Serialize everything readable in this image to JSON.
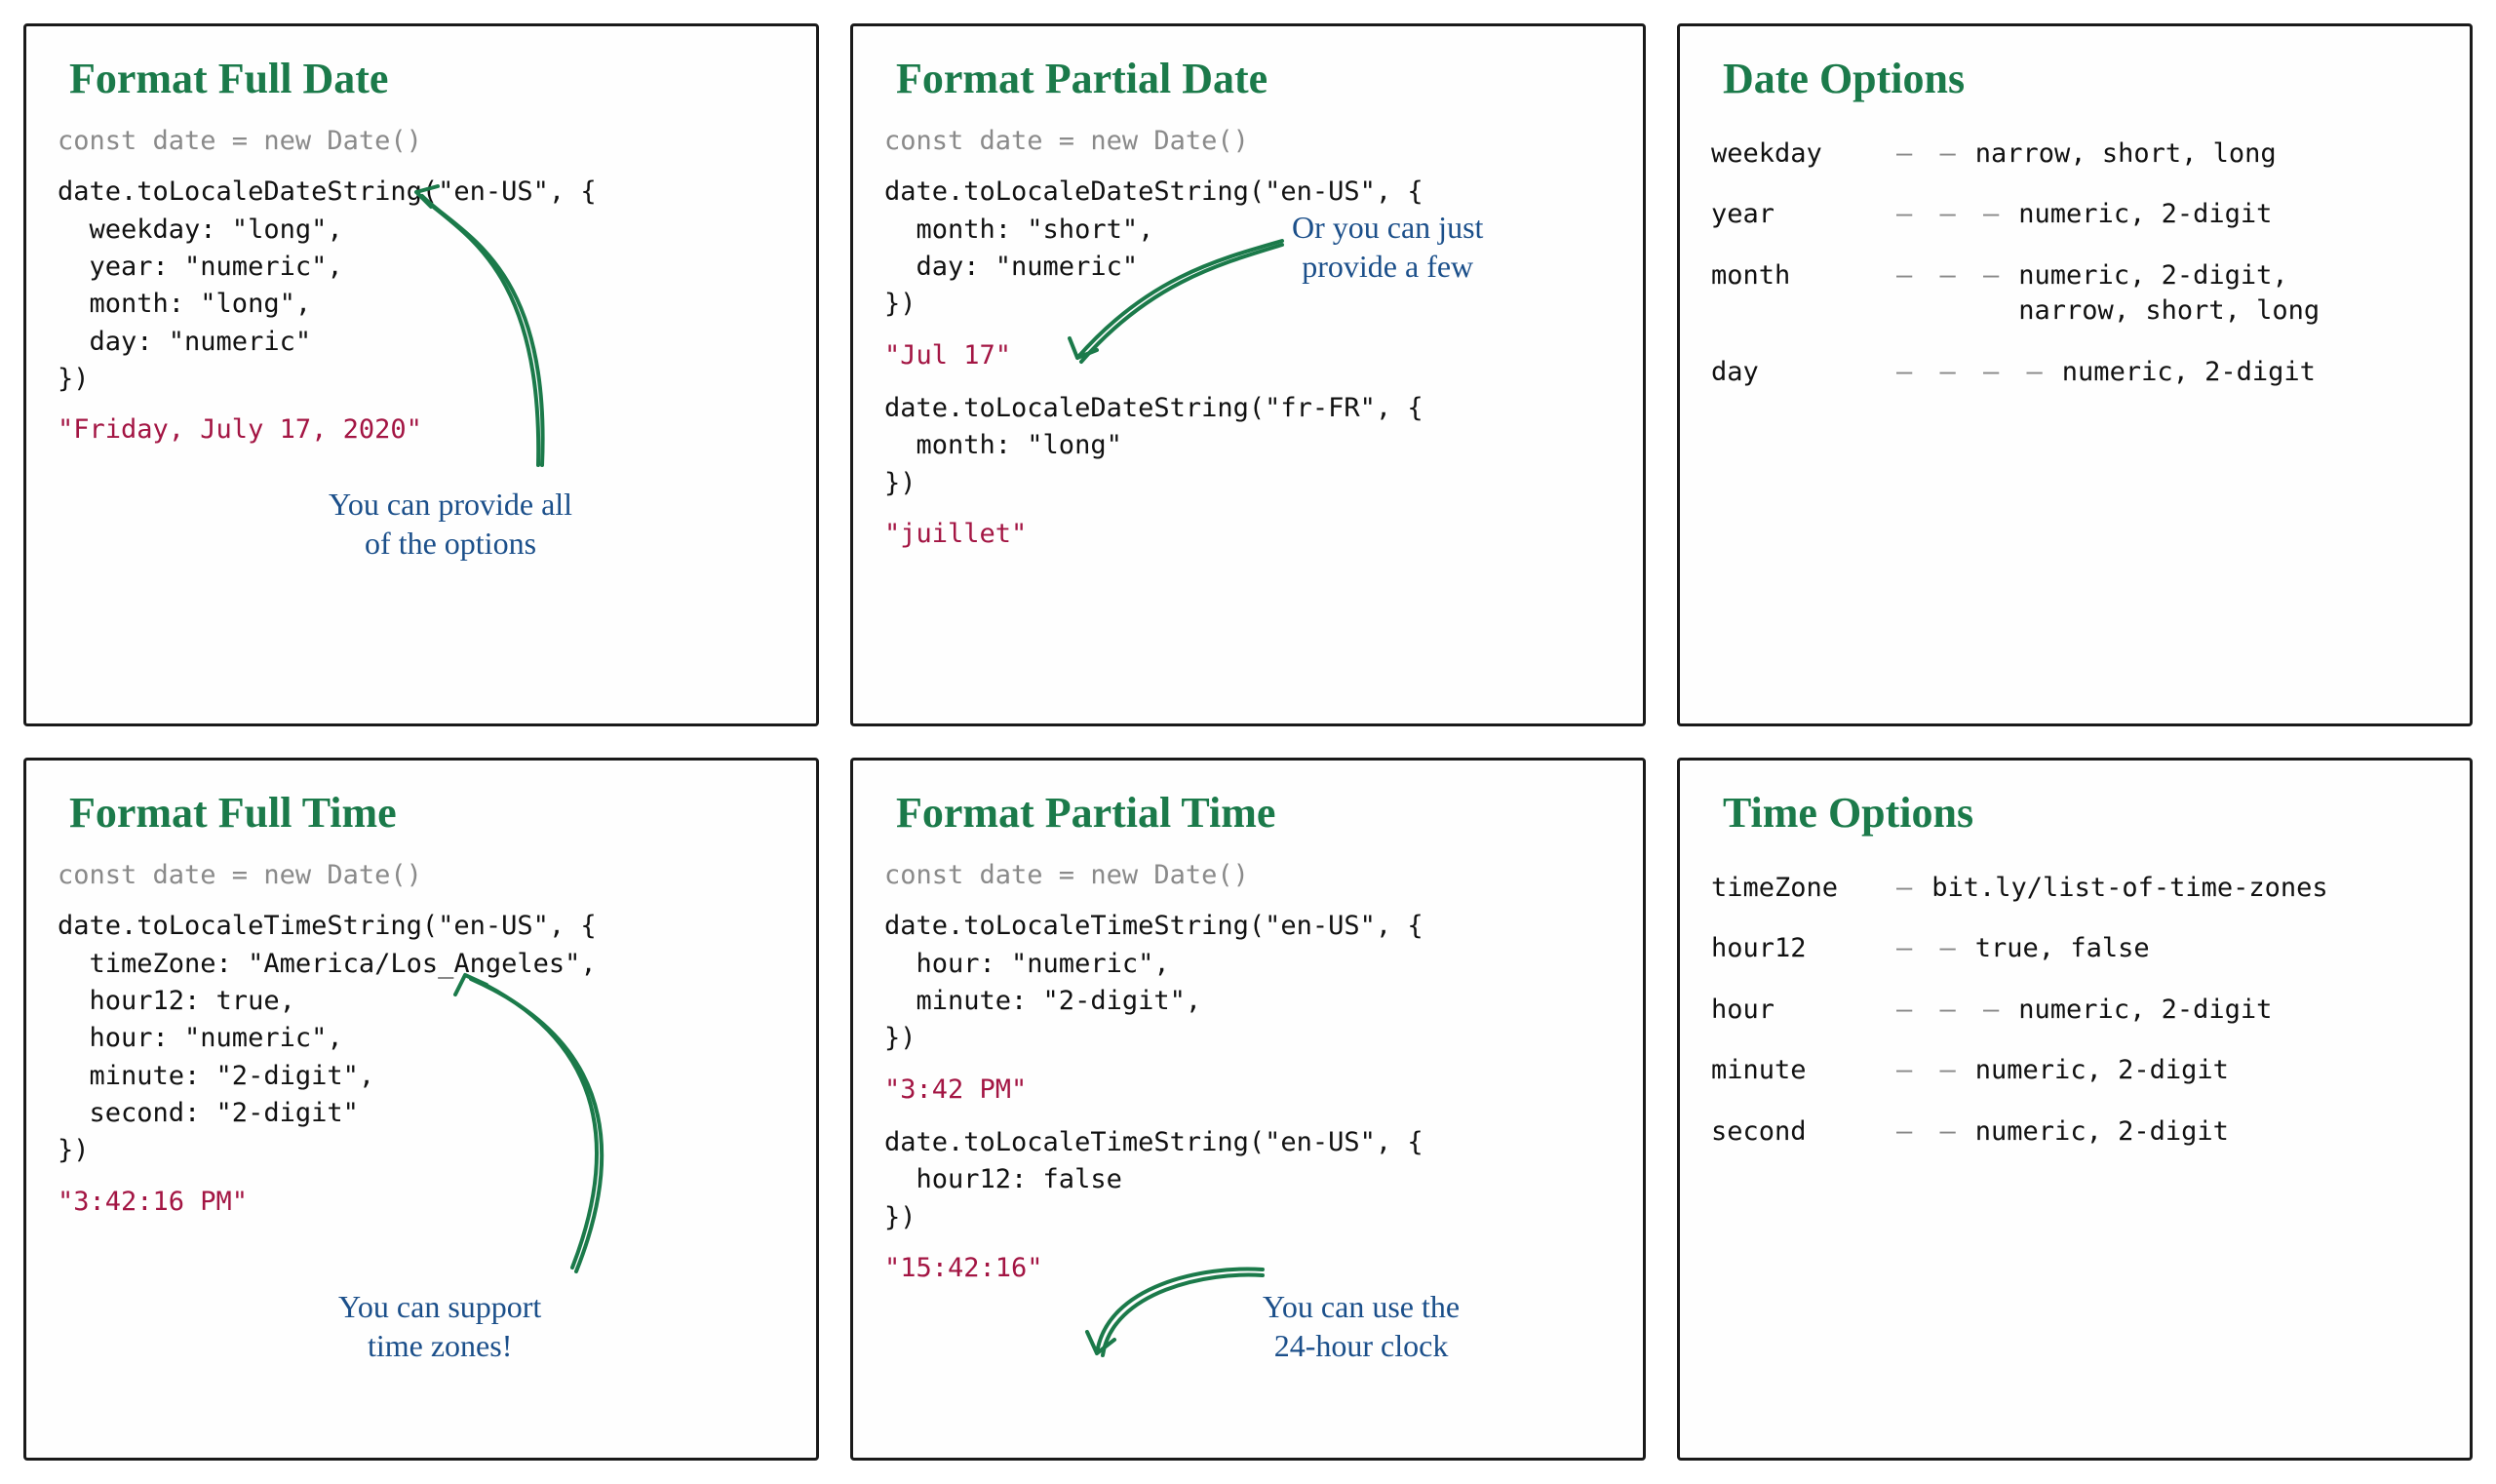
{
  "cards": {
    "fullDate": {
      "title": "Format Full Date",
      "decl": "const date = new Date()",
      "code": "date.toLocaleDateString(\"en-US\", {\n  weekday: \"long\",\n  year: \"numeric\",\n  month: \"long\",\n  day: \"numeric\"\n})",
      "output": "\"Friday, July 17, 2020\"",
      "annot": "You can provide all\nof the options"
    },
    "partialDate": {
      "title": "Format Partial Date",
      "decl": "const date = new Date()",
      "code1": "date.toLocaleDateString(\"en-US\", {\n  month: \"short\",\n  day: \"numeric\"\n})",
      "out1": "\"Jul 17\"",
      "code2": "date.toLocaleDateString(\"fr-FR\", {\n  month: \"long\"\n})",
      "out2": "\"juillet\"",
      "annot": "Or you can just\nprovide a few"
    },
    "dateOptions": {
      "title": "Date Options",
      "rows": {
        "weekday": {
          "key": "weekday",
          "dash": "— —",
          "val": "narrow, short, long"
        },
        "year": {
          "key": "year",
          "dash": "— — —",
          "val": "numeric, 2-digit"
        },
        "month": {
          "key": "month",
          "dash": "— — —",
          "val": "numeric, 2-digit,\nnarrow, short, long"
        },
        "day": {
          "key": "day",
          "dash": "— — — —",
          "val": "numeric, 2-digit"
        }
      }
    },
    "fullTime": {
      "title": "Format Full Time",
      "decl": "const date = new Date()",
      "code": "date.toLocaleTimeString(\"en-US\", {\n  timeZone: \"America/Los_Angeles\",\n  hour12: true,\n  hour: \"numeric\",\n  minute: \"2-digit\",\n  second: \"2-digit\"\n})",
      "output": "\"3:42:16 PM\"",
      "annot": "You can support\ntime zones!"
    },
    "partialTime": {
      "title": "Format Partial Time",
      "decl": "const date = new Date()",
      "code1": "date.toLocaleTimeString(\"en-US\", {\n  hour: \"numeric\",\n  minute: \"2-digit\",\n})",
      "out1": "\"3:42 PM\"",
      "code2": "date.toLocaleTimeString(\"en-US\", {\n  hour12: false\n})",
      "out2": "\"15:42:16\"",
      "annot": "You can use the\n24-hour clock"
    },
    "timeOptions": {
      "title": "Time Options",
      "rows": {
        "timeZone": {
          "key": "timeZone",
          "dash": "—",
          "val": "bit.ly/list-of-time-zones"
        },
        "hour12": {
          "key": "hour12",
          "dash": "— —",
          "val": "true, false"
        },
        "hour": {
          "key": "hour",
          "dash": "— — —",
          "val": "numeric, 2-digit"
        },
        "minute": {
          "key": "minute",
          "dash": "— —",
          "val": "numeric, 2-digit"
        },
        "second": {
          "key": "second",
          "dash": "— —",
          "val": "numeric, 2-digit"
        }
      }
    }
  }
}
